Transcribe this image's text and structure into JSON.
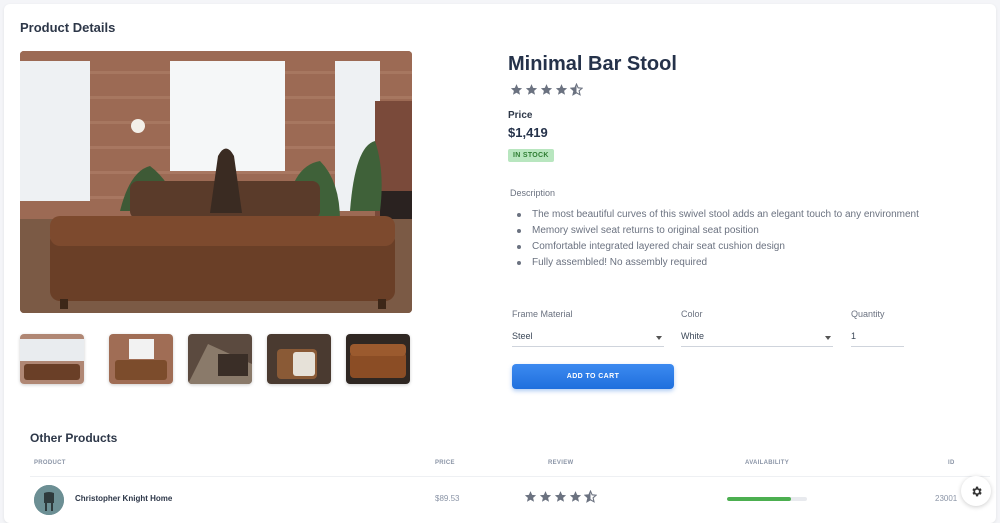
{
  "page": {
    "title": "Product Details"
  },
  "product": {
    "name": "Minimal Bar Stool",
    "rating": 4.5,
    "price_label": "Price",
    "price": "$1,419",
    "stock_badge": "IN STOCK",
    "description_label": "Description",
    "description": [
      "The most beautiful curves of this swivel stool adds an elegant touch to any environment",
      "Memory swivel seat returns to original seat position",
      "Comfortable integrated layered chair seat cushion design",
      "Fully assembled! No assembly required"
    ],
    "options": {
      "frame_label": "Frame Material",
      "frame_value": "Steel",
      "color_label": "Color",
      "color_value": "White",
      "quantity_label": "Quantity",
      "quantity_value": "1"
    },
    "add_to_cart": "ADD TO CART"
  },
  "other_products": {
    "title": "Other Products",
    "columns": {
      "product": "PRODUCT",
      "price": "PRICE",
      "review": "REVIEW",
      "availability": "AVAILABILITY",
      "id": "ID"
    },
    "rows": [
      {
        "name": "Christopher Knight Home",
        "price": "$89.53",
        "rating": 4.5,
        "availability": 0.8,
        "id": "23001"
      }
    ]
  },
  "colors": {
    "accent": "#1f6fdd",
    "badge_bg": "#b8e6bf",
    "badge_text": "#2e7d32",
    "availability": "#4caf50"
  },
  "icons": {
    "settings": "gear-icon",
    "star": "star-icon"
  }
}
